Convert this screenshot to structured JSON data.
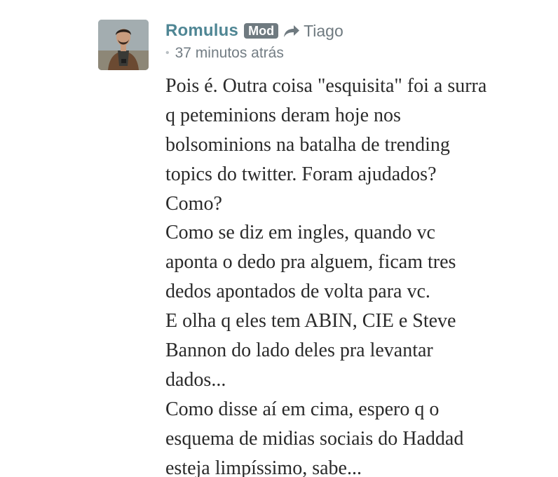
{
  "comment": {
    "author": "Romulus",
    "badge": "Mod",
    "reply_icon": "reply-arrow-icon",
    "reply_to": "Tiago",
    "bullet": "•",
    "timestamp": "37 minutos atrás",
    "avatar_icon": "user-avatar",
    "body_lines": [
      "Pois é. Outra coisa \"esquisita\" foi a surra",
      "q peteminions deram hoje nos",
      "bolsominions na batalha de trending",
      "topics do twitter. Foram ajudados?",
      "Como?",
      "Como se diz em ingles, quando vc",
      "aponta o dedo pra alguem, ficam tres",
      "dedos apontados de volta para vc.",
      "E olha q eles tem ABIN, CIE e Steve",
      "Bannon do lado deles pra levantar",
      "dados...",
      "Como disse aí em cima, espero q o",
      "esquema de midias sociais do Haddad",
      "esteja limpíssimo, sabe..."
    ]
  },
  "colors": {
    "author": "#4f8694",
    "badge_bg": "#6f7a80",
    "meta": "#737d84",
    "text": "#2a2a2a"
  }
}
